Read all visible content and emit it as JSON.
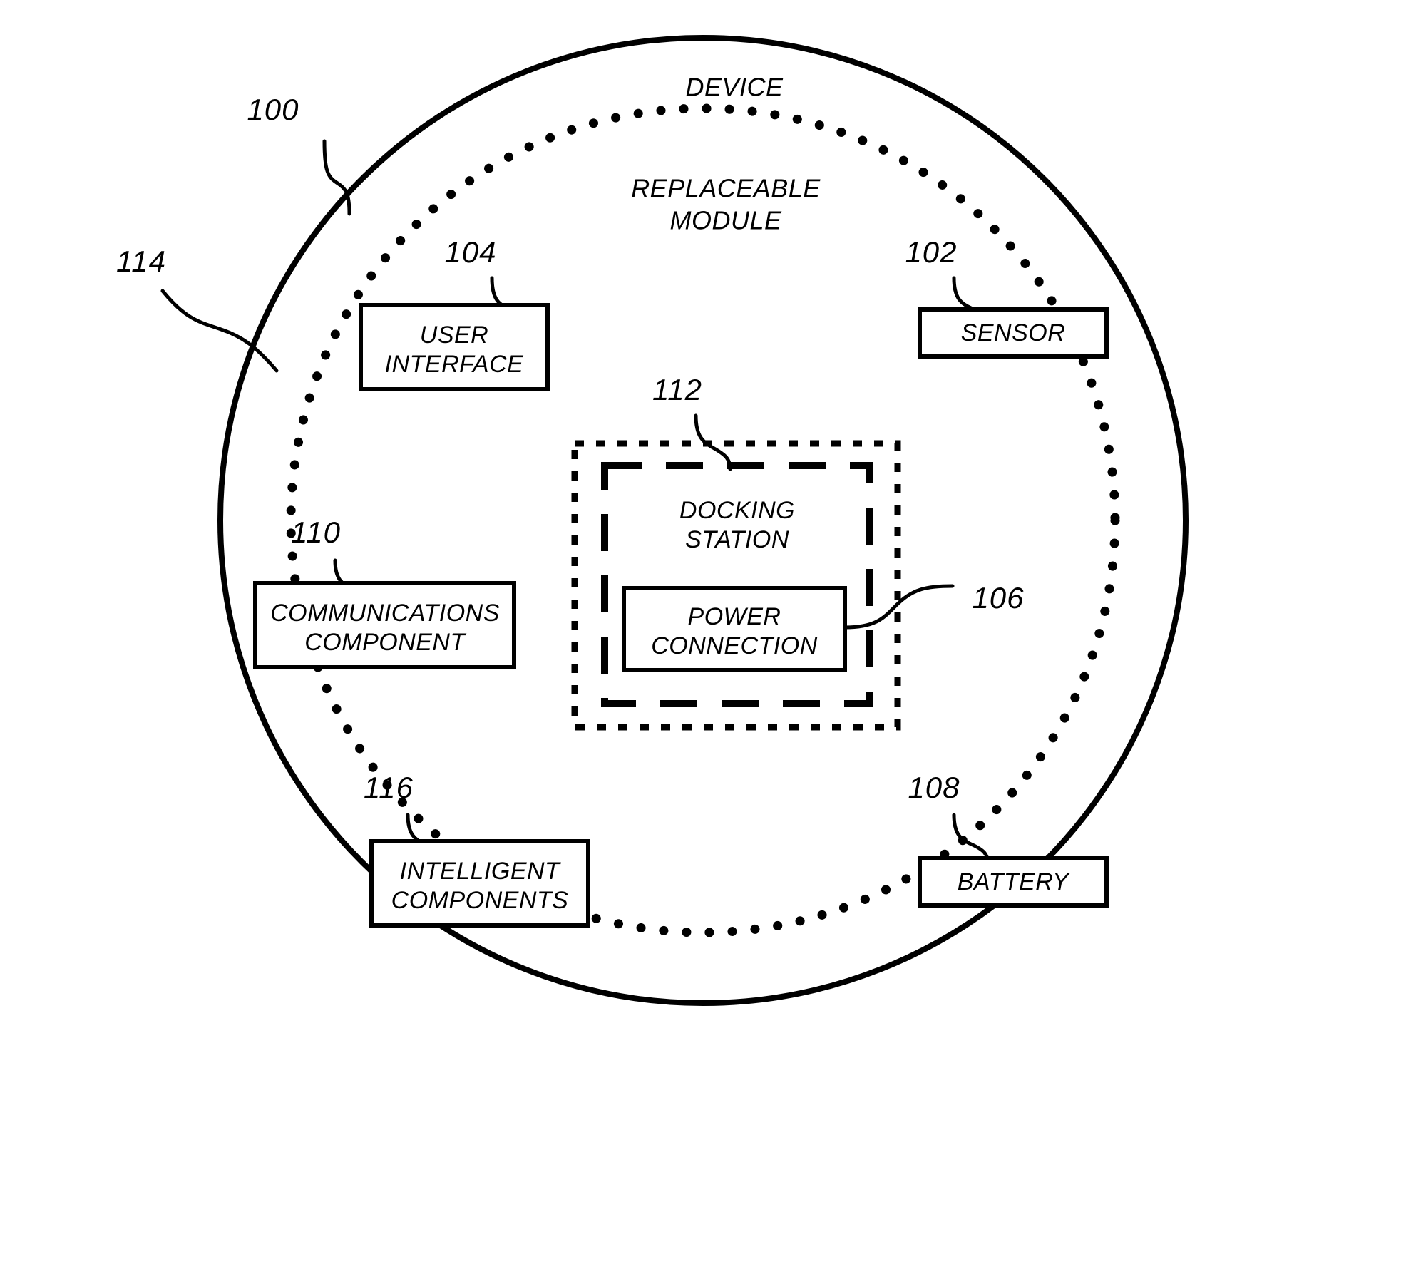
{
  "figure": {
    "outer_region": {
      "label": "DEVICE",
      "ref": "100"
    },
    "inner_region": {
      "label": "REPLACEABLE\nMODULE",
      "label_line1": "REPLACEABLE",
      "label_line2": "MODULE",
      "ref": "114"
    },
    "docking_region": {
      "ref": "112",
      "label_line1": "DOCKING",
      "label_line2": "STATION"
    },
    "boxes": [
      {
        "name": "user-interface",
        "ref": "104",
        "label_line1": "USER",
        "label_line2": "INTERFACE"
      },
      {
        "name": "sensor",
        "ref": "102",
        "label_line1": "SENSOR",
        "label_line2": ""
      },
      {
        "name": "communications-component",
        "ref": "110",
        "label_line1": "COMMUNICATIONS",
        "label_line2": "COMPONENT"
      },
      {
        "name": "power-connection",
        "ref": "106",
        "label_line1": "POWER",
        "label_line2": "CONNECTION"
      },
      {
        "name": "intelligent-components",
        "ref": "116",
        "label_line1": "INTELLIGENT",
        "label_line2": "COMPONENTS"
      },
      {
        "name": "battery",
        "ref": "108",
        "label_line1": "BATTERY",
        "label_line2": ""
      }
    ],
    "colors": {
      "ink": "#000000",
      "paper": "#ffffff"
    }
  }
}
